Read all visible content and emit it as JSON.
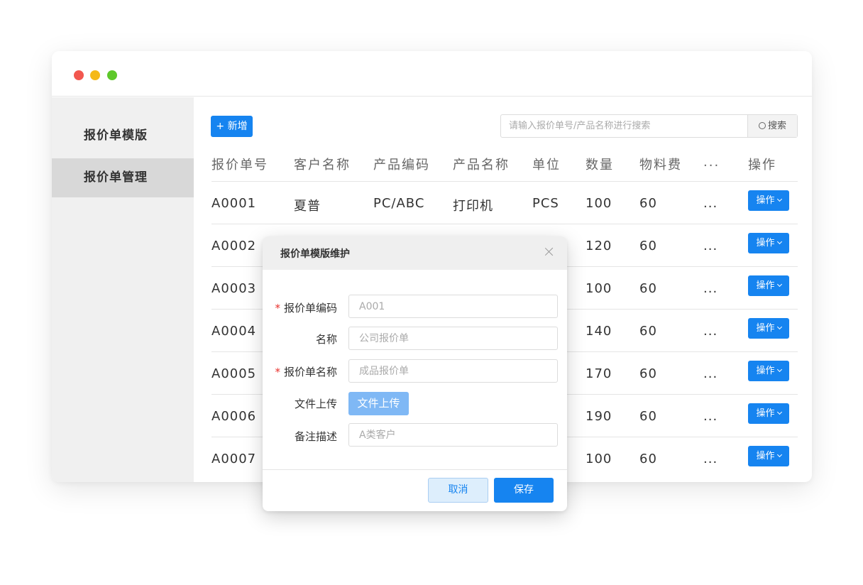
{
  "window": {
    "traffic_lights": {
      "red": "#f2574f",
      "yellow": "#f5b917",
      "green": "#5ec82a"
    }
  },
  "sidebar": {
    "items": [
      {
        "label": "报价单模版",
        "active": false
      },
      {
        "label": "报价单管理",
        "active": true
      }
    ]
  },
  "toolbar": {
    "add_label": "+ 新增",
    "search_placeholder": "请输入报价单号/产品名称进行搜索",
    "search_label": "搜索"
  },
  "table": {
    "headers": [
      "报价单号",
      "客户名称",
      "产品编码",
      "产品名称",
      "单位",
      "数量",
      "物料费",
      "...",
      "操作"
    ],
    "rows": [
      {
        "id": "A0001",
        "customer": "夏普",
        "code": "PC/ABC",
        "product": "打印机",
        "unit": "PCS",
        "qty": "100",
        "material": "60",
        "more": "...",
        "action": "操作"
      },
      {
        "id": "A0002",
        "customer": "",
        "code": "",
        "product": "",
        "unit": "",
        "qty": "120",
        "material": "60",
        "more": "...",
        "action": "操作"
      },
      {
        "id": "A0003",
        "customer": "",
        "code": "",
        "product": "",
        "unit": "",
        "qty": "100",
        "material": "60",
        "more": "...",
        "action": "操作"
      },
      {
        "id": "A0004",
        "customer": "",
        "code": "",
        "product": "",
        "unit": "",
        "qty": "140",
        "material": "60",
        "more": "...",
        "action": "操作"
      },
      {
        "id": "A0005",
        "customer": "",
        "code": "",
        "product": "",
        "unit": "",
        "qty": "170",
        "material": "60",
        "more": "...",
        "action": "操作"
      },
      {
        "id": "A0006",
        "customer": "",
        "code": "",
        "product": "",
        "unit": "",
        "qty": "190",
        "material": "60",
        "more": "...",
        "action": "操作"
      },
      {
        "id": "A0007",
        "customer": "",
        "code": "",
        "product": "",
        "unit": "",
        "qty": "100",
        "material": "60",
        "more": "...",
        "action": "操作"
      }
    ]
  },
  "modal": {
    "title": "报价单模版维护",
    "fields": [
      {
        "label": "报价单编码",
        "required": true,
        "placeholder": "A001"
      },
      {
        "label": "名称",
        "required": false,
        "placeholder": "公司报价单"
      },
      {
        "label": "报价单名称",
        "required": true,
        "placeholder": "成品报价单"
      },
      {
        "label": "文件上传",
        "required": false,
        "button": "文件上传"
      },
      {
        "label": "备注描述",
        "required": false,
        "placeholder": "A类客户"
      }
    ],
    "required_mark": "*",
    "cancel_label": "取消",
    "save_label": "保存"
  },
  "colors": {
    "primary": "#1684f0",
    "upload_button": "#7fb8f5",
    "required": "#e8312c",
    "sidebar_bg": "#f0f0f0",
    "sidebar_active_bg": "#d8d8d8"
  }
}
